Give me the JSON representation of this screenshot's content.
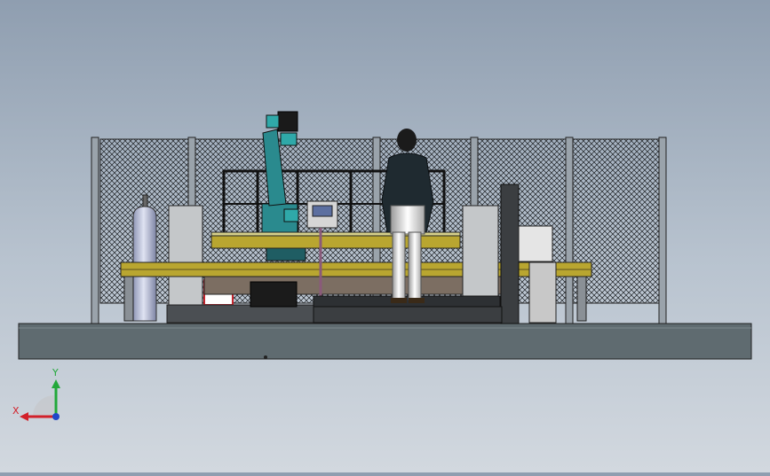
{
  "triad": {
    "x_label": "X",
    "y_label": "Y"
  },
  "colors": {
    "background_top": "#8f9eb0",
    "background_bottom": "#d2d8df",
    "base_platform": "#5f6b70",
    "fence_mesh": "#1c1f22",
    "rail_yellow": "#b9a630",
    "robot_teal": "#2a8a8e",
    "gas_cylinder": "#b9bfd8",
    "axis_x": "#d2202a",
    "axis_y": "#22a83a",
    "axis_z": "#2146c8"
  },
  "icons": [
    "coordinate-triad-icon"
  ]
}
